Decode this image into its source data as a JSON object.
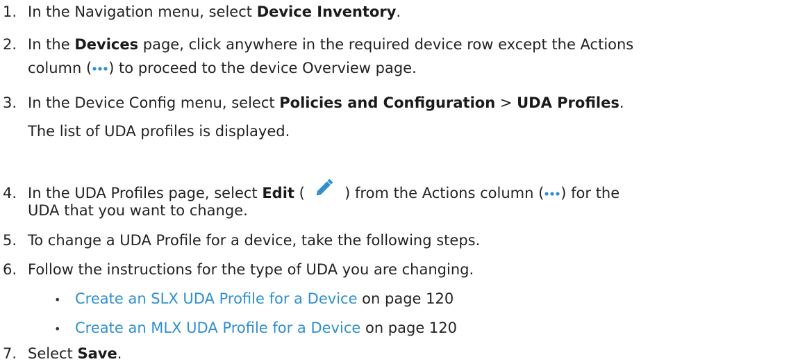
{
  "steps": [
    {
      "num": "1.",
      "t1": "In the Navigation menu, select ",
      "b1": "Device Inventory",
      "t2": "."
    },
    {
      "num": "2.",
      "t1": "In the ",
      "b1": "Devices",
      "t2": " page, click anywhere in the required device row except the Actions",
      "line2_a": "column (",
      "line2_b": ") to proceed to the device Overview page."
    },
    {
      "num": "3.",
      "t1": "In the Device Config menu, select ",
      "b1": "Policies and Configuration",
      "t2": " > ",
      "b2": "UDA Profiles",
      "t3": ".",
      "result": "The list of UDA profiles is displayed."
    },
    {
      "num": "4.",
      "t1": "In the UDA Profiles page, select ",
      "b1": "Edit",
      "t2": " ( ",
      "t3": " ) from the Actions column (",
      "t4": ") for the",
      "line2": "UDA that you want to change."
    },
    {
      "num": "5.",
      "t1": "To change a UDA Profile for a device, take the following steps."
    },
    {
      "num": "6.",
      "t1": "Follow the instructions for the type of UDA you are changing."
    },
    {
      "num": "7.",
      "t1": "Select ",
      "b1": "Save",
      "t2": "."
    }
  ],
  "links": [
    {
      "bullet": "•",
      "text": "Create an SLX UDA Profile for a Device",
      "suffix": " on page 120"
    },
    {
      "bullet": "•",
      "text": "Create an MLX UDA Profile for a Device",
      "suffix": " on page 120"
    }
  ],
  "icons": {
    "actions": "more-horizontal-dots-icon",
    "edit": "pencil-edit-icon"
  },
  "colors": {
    "link": "#2f8fd0",
    "dots": "#2f8fd0",
    "pencil": "#2f8fd0"
  }
}
